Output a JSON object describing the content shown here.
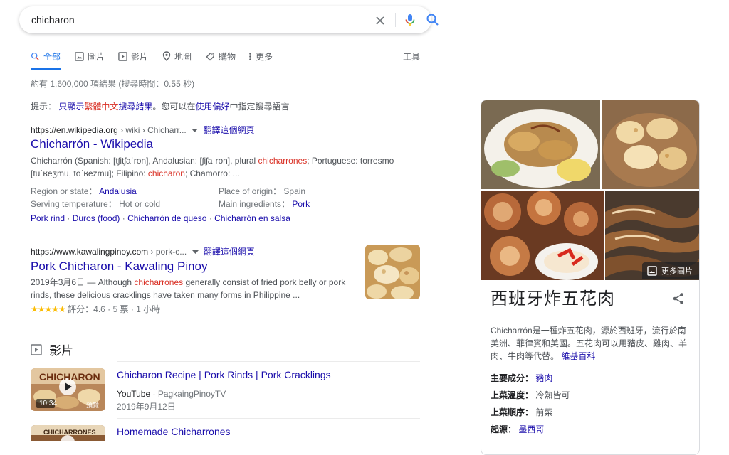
{
  "search": {
    "query": "chicharon"
  },
  "tabs": [
    {
      "label": "全部",
      "icon": "search-icon"
    },
    {
      "label": "圖片",
      "icon": "image-icon"
    },
    {
      "label": "影片",
      "icon": "video-icon"
    },
    {
      "label": "地圖",
      "icon": "map-pin-icon"
    },
    {
      "label": "購物",
      "icon": "tag-icon"
    },
    {
      "label": "更多",
      "icon": "more-vert-icon"
    }
  ],
  "tools_label": "工具",
  "stats": "約有 1,600,000 項結果 (搜尋時間：0.55 秒)",
  "hint": {
    "prefix": "提示：",
    "link1": "只顯示",
    "red": "繁體中文",
    "link2": "搜尋結果",
    "middle": "。您可以在",
    "prefs": "使用偏好",
    "suffix": "中指定搜尋語言"
  },
  "result1": {
    "url": "https://en.wikipedia.org",
    "path": " › wiki › Chicharr...",
    "translate": "翻譯這個網頁",
    "title": "Chicharrón - Wikipedia",
    "snippet_a": "Chicharrón (Spanish: [tʃitʃaˈron], Andalusian: [ʃiʃaˈron], plural ",
    "snippet_hl1": "chicharrones",
    "snippet_b": "; Portuguese: torresmo",
    "snippet_c": "[tuˈʁeʒmu, toˈʁezmu]; Filipino: ",
    "snippet_hl2": "chicharon",
    "snippet_d": "; Chamorro: ...",
    "facts": [
      {
        "key": "Region or state",
        "value": "Andalusia",
        "link": true
      },
      {
        "key": "Place of origin",
        "value": "Spain",
        "link": false
      },
      {
        "key": "Serving temperature",
        "value": "Hot or cold",
        "link": false
      },
      {
        "key": "Main ingredients",
        "value": "Pork",
        "link": true
      }
    ],
    "sitelinks": [
      "Pork rind",
      "Duros (food)",
      "Chicharrón de queso",
      "Chicharrón en salsa"
    ]
  },
  "result2": {
    "url": "https://www.kawalingpinoy.com",
    "path": " › pork-c...",
    "translate": "翻譯這個網頁",
    "title": "Pork Chicharon - Kawaling Pinoy",
    "snippet_date": "2019年3月6日 — Although ",
    "snippet_hl": "chicharrones",
    "snippet_a": " generally consist of fried pork belly or pork",
    "snippet_b": "rinds, these delicious cracklings have taken many forms in Philippine ...",
    "stars": "★★★★★",
    "rating": "評分：4.6 · 5 票 · 1 小時"
  },
  "videos": {
    "heading": "影片",
    "items": [
      {
        "title": "Chicharon Recipe | Pork Rinds | Pork Cracklings",
        "source": "YouTube",
        "channel": "PagkaingPinoyTV",
        "date": "2019年9月12日",
        "thumb_text": "CHICHARON",
        "duration": "10:34",
        "preview": "預覽"
      },
      {
        "title": "Homemade Chicharrones",
        "thumb_text": "CHICHARRONES"
      }
    ]
  },
  "knowledge_panel": {
    "more_images": "更多圖片",
    "title": "西班牙炸五花肉",
    "description": "Chicharrón是一種炸五花肉，源於西班牙，流行於南美洲、菲律賓和美國。五花肉可以用豬皮、雞肉、羊肉、牛肉等代替。",
    "source": "維基百科",
    "facts": [
      {
        "key": "主要成分：",
        "value": "豬肉",
        "link": true
      },
      {
        "key": "上菜溫度：",
        "value": "冷熱皆可",
        "link": false
      },
      {
        "key": "上菜順序：",
        "value": "前菜",
        "link": false
      },
      {
        "key": "起源：",
        "value": "墨西哥",
        "link": true
      }
    ]
  },
  "colors": {
    "link": "#1a0dab",
    "accent": "#1a73e8",
    "highlight": "#d93025",
    "star": "#fbbc04"
  }
}
